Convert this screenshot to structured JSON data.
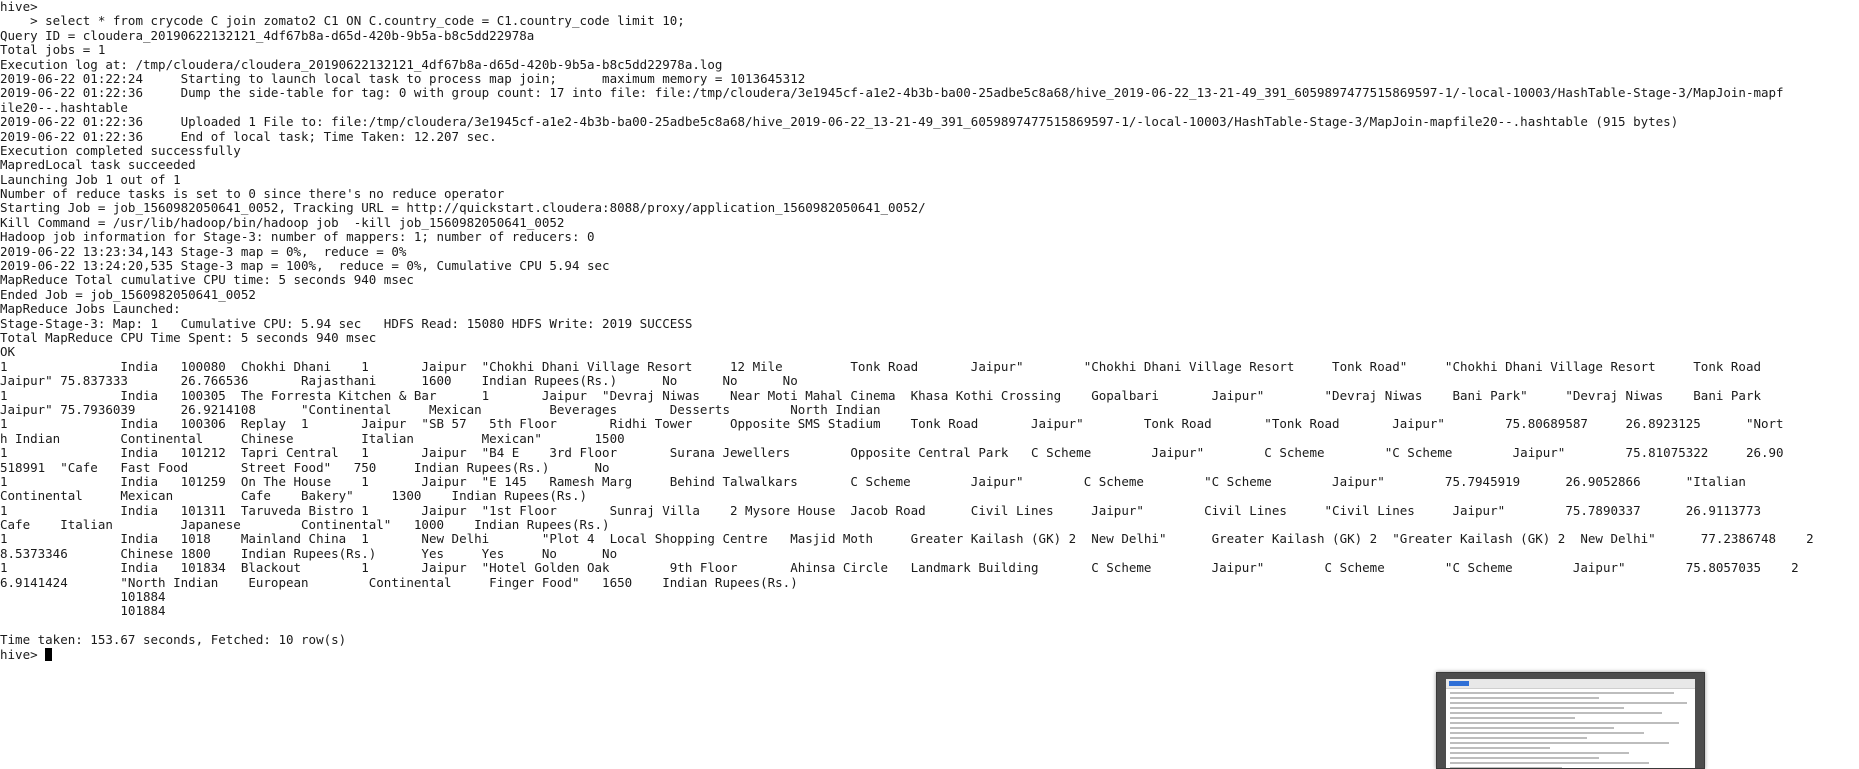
{
  "terminal": {
    "lines": [
      "hive>",
      "    > select * from crycode C join zomato2 C1 ON C.country_code = C1.country_code limit 10;",
      "Query ID = cloudera_20190622132121_4df67b8a-d65d-420b-9b5a-b8c5dd22978a",
      "Total jobs = 1",
      "Execution log at: /tmp/cloudera/cloudera_20190622132121_4df67b8a-d65d-420b-9b5a-b8c5dd22978a.log",
      "2019-06-22 01:22:24     Starting to launch local task to process map join;      maximum memory = 1013645312",
      "2019-06-22 01:22:36     Dump the side-table for tag: 0 with group count: 17 into file: file:/tmp/cloudera/3e1945cf-a1e2-4b3b-ba00-25adbe5c8a68/hive_2019-06-22_13-21-49_391_6059897477515869597-1/-local-10003/HashTable-Stage-3/MapJoin-mapf",
      "ile20--.hashtable",
      "2019-06-22 01:22:36     Uploaded 1 File to: file:/tmp/cloudera/3e1945cf-a1e2-4b3b-ba00-25adbe5c8a68/hive_2019-06-22_13-21-49_391_6059897477515869597-1/-local-10003/HashTable-Stage-3/MapJoin-mapfile20--.hashtable (915 bytes)",
      "2019-06-22 01:22:36     End of local task; Time Taken: 12.207 sec.",
      "Execution completed successfully",
      "MapredLocal task succeeded",
      "Launching Job 1 out of 1",
      "Number of reduce tasks is set to 0 since there's no reduce operator",
      "Starting Job = job_1560982050641_0052, Tracking URL = http://quickstart.cloudera:8088/proxy/application_1560982050641_0052/",
      "Kill Command = /usr/lib/hadoop/bin/hadoop job  -kill job_1560982050641_0052",
      "Hadoop job information for Stage-3: number of mappers: 1; number of reducers: 0",
      "2019-06-22 13:23:34,143 Stage-3 map = 0%,  reduce = 0%",
      "2019-06-22 13:24:20,535 Stage-3 map = 100%,  reduce = 0%, Cumulative CPU 5.94 sec",
      "MapReduce Total cumulative CPU time: 5 seconds 940 msec",
      "Ended Job = job_1560982050641_0052",
      "MapReduce Jobs Launched:",
      "Stage-Stage-3: Map: 1   Cumulative CPU: 5.94 sec   HDFS Read: 15080 HDFS Write: 2019 SUCCESS",
      "Total MapReduce CPU Time Spent: 5 seconds 940 msec",
      "OK",
      "1               India   100080  Chokhi Dhani    1       Jaipur  \"Chokhi Dhani Village Resort     12 Mile         Tonk Road       Jaipur\"        \"Chokhi Dhani Village Resort     Tonk Road\"     \"Chokhi Dhani Village Resort     Tonk Road       ",
      "Jaipur\" 75.837333       26.766536       Rajasthani      1600    Indian Rupees(Rs.)      No      No      No",
      "1               India   100305  The Forresta Kitchen & Bar      1       Jaipur  \"Devraj Niwas    Near Moti Mahal Cinema  Khasa Kothi Crossing    Gopalbari       Jaipur\"        \"Devraj Niwas    Bani Park\"     \"Devraj Niwas    Bani Park       ",
      "Jaipur\" 75.7936039      26.9214108      \"Continental     Mexican         Beverages       Desserts        North Indian",
      "1               India   100306  Replay  1       Jaipur  \"SB 57   5th Floor       Ridhi Tower     Opposite SMS Stadium    Tonk Road       Jaipur\"        Tonk Road       \"Tonk Road       Jaipur\"        75.80689587     26.8923125      \"Nort",
      "h Indian        Continental     Chinese         Italian         Mexican\"       1500",
      "1               India   101212  Tapri Central   1       Jaipur  \"B4 E    3rd Floor       Surana Jewellers        Opposite Central Park   C Scheme        Jaipur\"        C Scheme        \"C Scheme        Jaipur\"        75.81075322     26.90",
      "518991  \"Cafe   Fast Food       Street Food\"   750     Indian Rupees(Rs.)      No",
      "1               India   101259  On The House    1       Jaipur  \"E 145   Ramesh Marg     Behind Talwalkars       C Scheme        Jaipur\"        C Scheme        \"C Scheme        Jaipur\"        75.7945919      26.9052866      \"Italian   ",
      "Continental     Mexican         Cafe    Bakery\"     1300    Indian Rupees(Rs.)",
      "1               India   101311  Taruveda Bistro 1       Jaipur  \"1st Floor       Sunraj Villa    2 Mysore House  Jacob Road      Civil Lines     Jaipur\"        Civil Lines     \"Civil Lines     Jaipur\"        75.7890337      26.9113773    ",
      "Cafe    Italian         Japanese        Continental\"   1000    Indian Rupees(Rs.)",
      "1               India   1018    Mainland China  1       New Delhi       \"Plot 4  Local Shopping Centre   Masjid Moth     Greater Kailash (GK) 2  New Delhi\"      Greater Kailash (GK) 2  \"Greater Kailash (GK) 2  New Delhi\"      77.2386748    2",
      "8.5373346       Chinese 1800    Indian Rupees(Rs.)      Yes     Yes     No      No",
      "1               India   101834  Blackout        1       Jaipur  \"Hotel Golden Oak        9th Floor       Ahinsa Circle   Landmark Building       C Scheme        Jaipur\"        C Scheme        \"C Scheme        Jaipur\"        75.8057035    2",
      "6.9141424       \"North Indian    European        Continental     Finger Food\"   1650    Indian Rupees(Rs.)",
      "                101884",
      "                101884",
      "",
      "Time taken: 153.67 seconds, Fetched: 10 row(s)"
    ],
    "prompt": "hive> "
  },
  "thumbnail": {
    "label": "window preview"
  }
}
